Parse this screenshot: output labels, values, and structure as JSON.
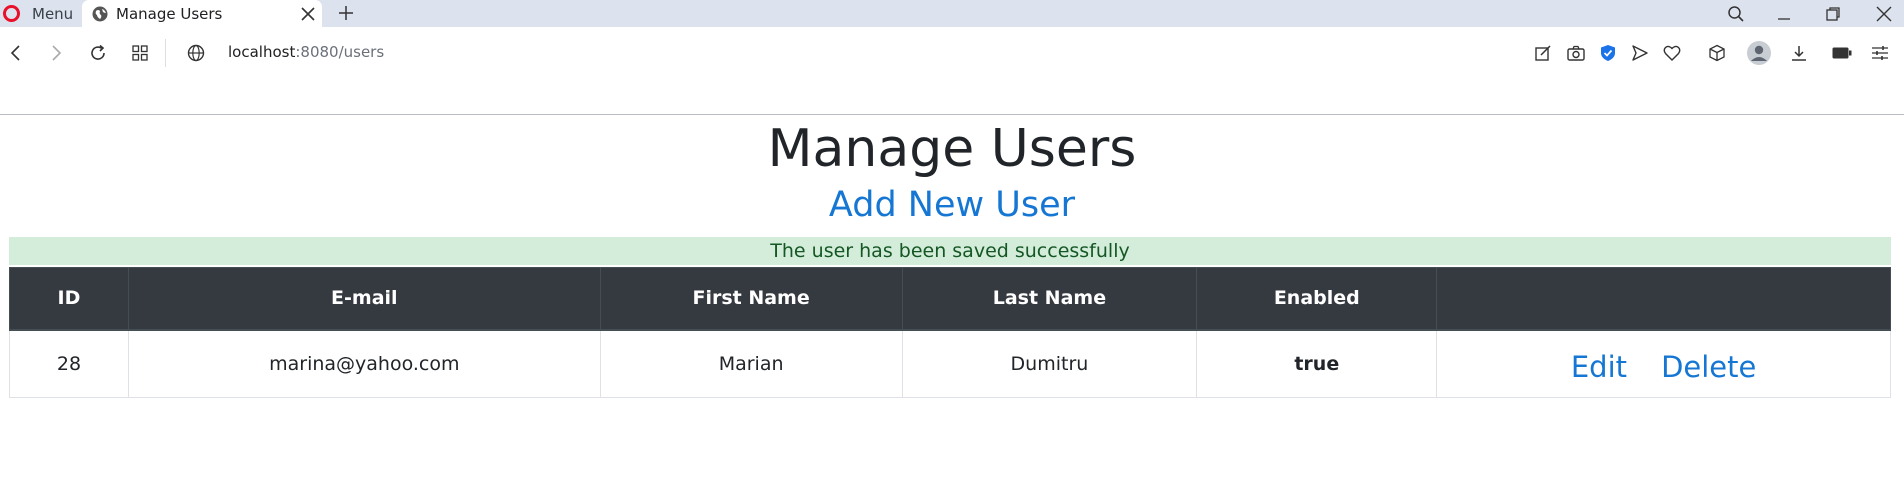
{
  "browser": {
    "menu_label": "Menu",
    "tab_title": "Manage Users",
    "url_host": "localhost",
    "url_path": ":8080/users"
  },
  "page": {
    "title": "Manage Users",
    "add_link": "Add New User",
    "alert": "The user has been saved successfully"
  },
  "table": {
    "headers": [
      "ID",
      "E-mail",
      "First Name",
      "Last Name",
      "Enabled",
      ""
    ],
    "rows": [
      {
        "id": "28",
        "email": "marina@yahoo.com",
        "first_name": "Marian",
        "last_name": "Dumitru",
        "enabled": "true",
        "edit": "Edit",
        "delete": "Delete"
      }
    ]
  },
  "colors": {
    "link": "#1577d3",
    "header_bg": "#343a40",
    "alert_bg": "#d4edda",
    "alert_text": "#155724",
    "brand": "#e8102a"
  }
}
